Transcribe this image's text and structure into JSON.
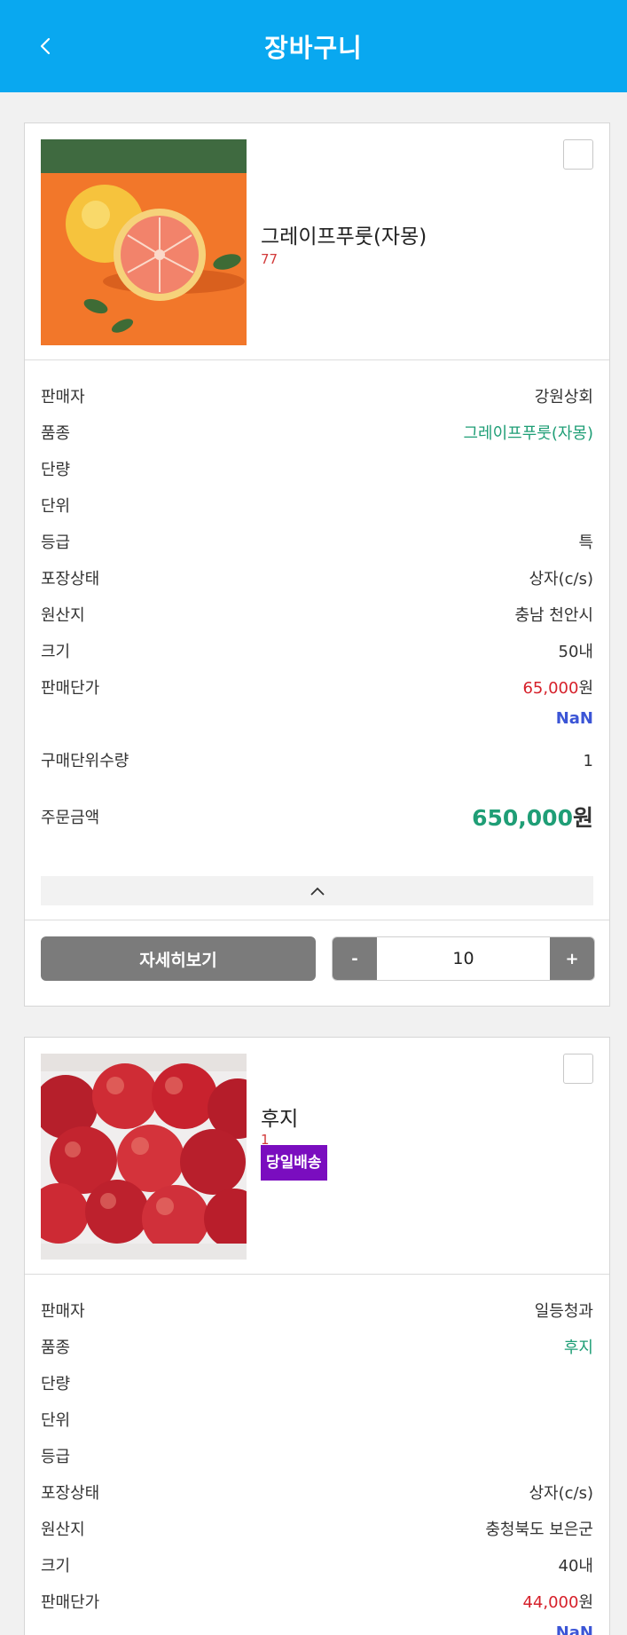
{
  "header": {
    "title": "장바구니"
  },
  "labels": {
    "seller": "판매자",
    "variety": "품종",
    "weight": "단량",
    "unit": "단위",
    "grade": "등급",
    "packaging": "포장상태",
    "origin": "원산지",
    "size": "크기",
    "unit_price": "판매단가",
    "purchase_unit_qty": "구매단위수량",
    "order_amount": "주문금액",
    "detail_button": "자세히보기",
    "minus": "-",
    "plus": "+"
  },
  "items": [
    {
      "name": "그레이프푸룻(자몽)",
      "qty_note": "77",
      "seller": "강원상회",
      "variety": "그레이프푸룻(자몽)",
      "weight": "",
      "unit": "",
      "grade": "특",
      "packaging": "상자(c/s)",
      "origin": "충남 천안시",
      "size": "50내",
      "unit_price": "65,000",
      "won": "원",
      "unit_price_sub": "NaN",
      "purchase_unit_qty": "1",
      "order_amount": "650,000",
      "quantity": "10"
    },
    {
      "name": "후지",
      "qty_note": "1",
      "badge": "당일배송",
      "seller": "일등청과",
      "variety": "후지",
      "weight": "",
      "unit": "",
      "grade": "",
      "packaging": "상자(c/s)",
      "origin": "충청북도 보은군",
      "size": "40내",
      "unit_price": "44,000",
      "won": "원",
      "unit_price_sub": "NaN"
    }
  ],
  "colors": {
    "header_bg": "#09a8f0",
    "accent_green": "#1f9e76",
    "price_red": "#d6202a",
    "nan_blue": "#3b55d6",
    "badge_purple": "#7a0dbf"
  }
}
